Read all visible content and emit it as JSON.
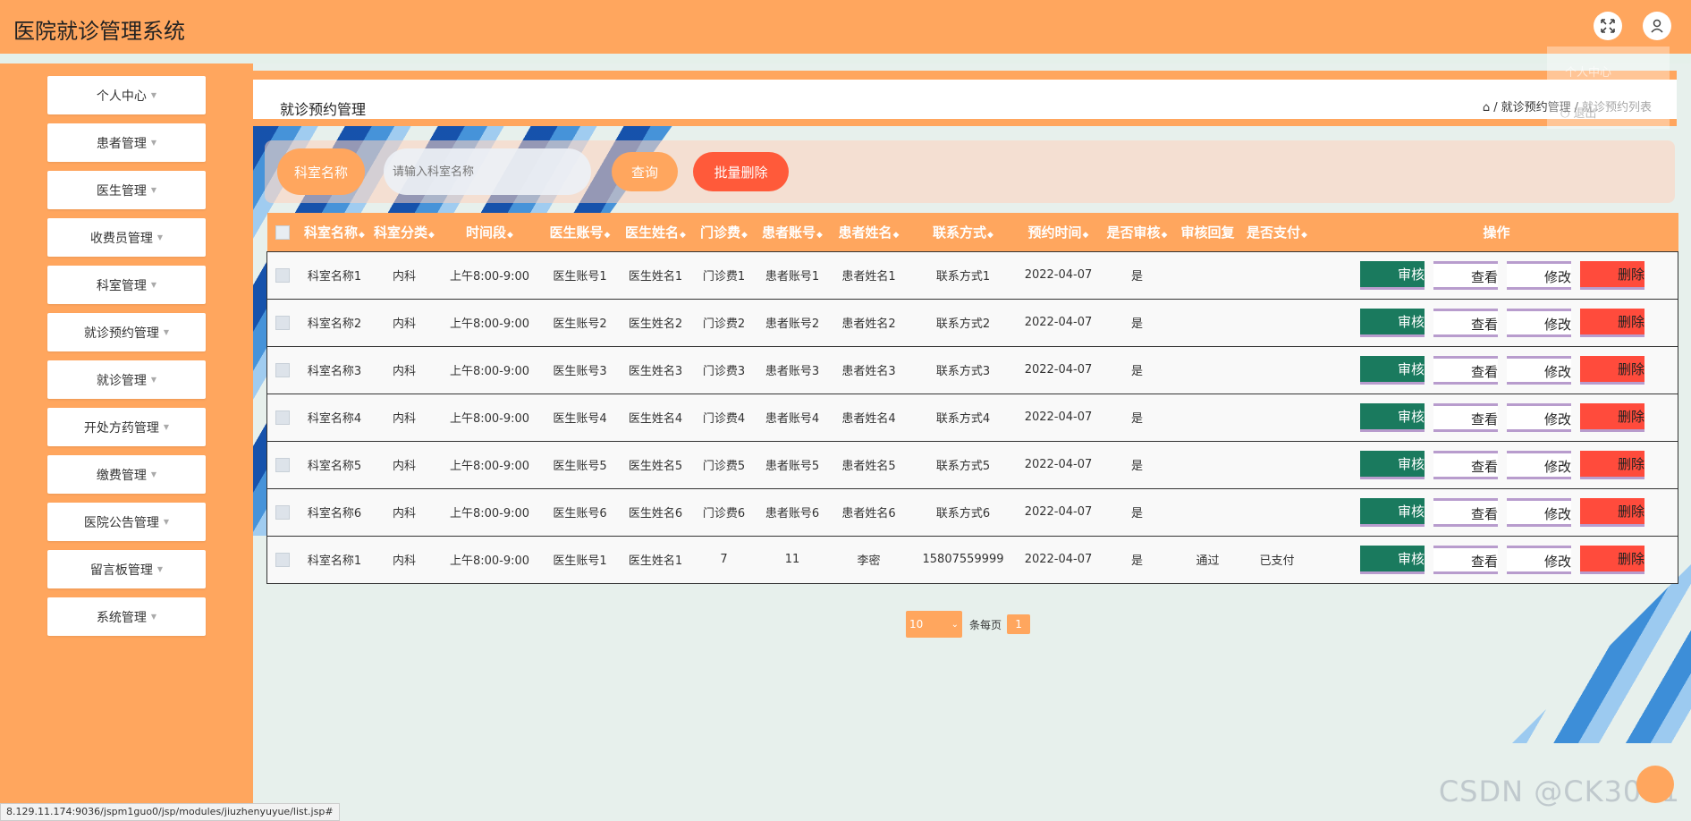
{
  "app": {
    "title": "医院就诊管理系统"
  },
  "topbar": {
    "fullscreen_icon": "expand-icon",
    "user_icon": "user-icon"
  },
  "user_menu": {
    "item1": "个人中心",
    "item2": "退出"
  },
  "sidebar": {
    "items": [
      {
        "label": "个人中心"
      },
      {
        "label": "患者管理"
      },
      {
        "label": "医生管理"
      },
      {
        "label": "收费员管理"
      },
      {
        "label": "科室管理"
      },
      {
        "label": "就诊预约管理"
      },
      {
        "label": "就诊管理"
      },
      {
        "label": "开处方药管理"
      },
      {
        "label": "缴费管理"
      },
      {
        "label": "医院公告管理"
      },
      {
        "label": "留言板管理"
      },
      {
        "label": "系统管理"
      }
    ]
  },
  "header": {
    "title": "就诊预约管理",
    "breadcrumb": [
      "就诊预约管理",
      "就诊预约列表"
    ]
  },
  "search": {
    "label": "科室名称",
    "placeholder": "请输入科室名称",
    "query_button": "查询",
    "batch_delete_button": "批量删除"
  },
  "table": {
    "columns": [
      "科室名称",
      "科室分类",
      "时间段",
      "医生账号",
      "医生姓名",
      "门诊费",
      "患者账号",
      "患者姓名",
      "联系方式",
      "预约时间",
      "是否审核",
      "审核回复",
      "是否支付",
      "操作"
    ],
    "actions": {
      "audit": "审核",
      "view": "查看",
      "edit": "修改",
      "delete": "删除"
    },
    "rows": [
      [
        "科室名称1",
        "内科",
        "上午8:00-9:00",
        "医生账号1",
        "医生姓名1",
        "门诊费1",
        "患者账号1",
        "患者姓名1",
        "联系方式1",
        "2022-04-07",
        "是",
        "",
        ""
      ],
      [
        "科室名称2",
        "内科",
        "上午8:00-9:00",
        "医生账号2",
        "医生姓名2",
        "门诊费2",
        "患者账号2",
        "患者姓名2",
        "联系方式2",
        "2022-04-07",
        "是",
        "",
        ""
      ],
      [
        "科室名称3",
        "内科",
        "上午8:00-9:00",
        "医生账号3",
        "医生姓名3",
        "门诊费3",
        "患者账号3",
        "患者姓名3",
        "联系方式3",
        "2022-04-07",
        "是",
        "",
        ""
      ],
      [
        "科室名称4",
        "内科",
        "上午8:00-9:00",
        "医生账号4",
        "医生姓名4",
        "门诊费4",
        "患者账号4",
        "患者姓名4",
        "联系方式4",
        "2022-04-07",
        "是",
        "",
        ""
      ],
      [
        "科室名称5",
        "内科",
        "上午8:00-9:00",
        "医生账号5",
        "医生姓名5",
        "门诊费5",
        "患者账号5",
        "患者姓名5",
        "联系方式5",
        "2022-04-07",
        "是",
        "",
        ""
      ],
      [
        "科室名称6",
        "内科",
        "上午8:00-9:00",
        "医生账号6",
        "医生姓名6",
        "门诊费6",
        "患者账号6",
        "患者姓名6",
        "联系方式6",
        "2022-04-07",
        "是",
        "",
        ""
      ],
      [
        "科室名称1",
        "内科",
        "上午8:00-9:00",
        "医生账号1",
        "医生姓名1",
        "7",
        "11",
        "李密",
        "15807559999",
        "2022-04-07",
        "是",
        "通过",
        "已支付"
      ]
    ]
  },
  "pagination": {
    "page_size": "10",
    "per_page_label": "条每页",
    "current_page": "1"
  },
  "status_bar": {
    "url": "8.129.11.174:9036/jspm1guo0/jsp/modules/jiuzhenyuyue/list.jsp#"
  },
  "watermark": "CSDN @CK3011"
}
